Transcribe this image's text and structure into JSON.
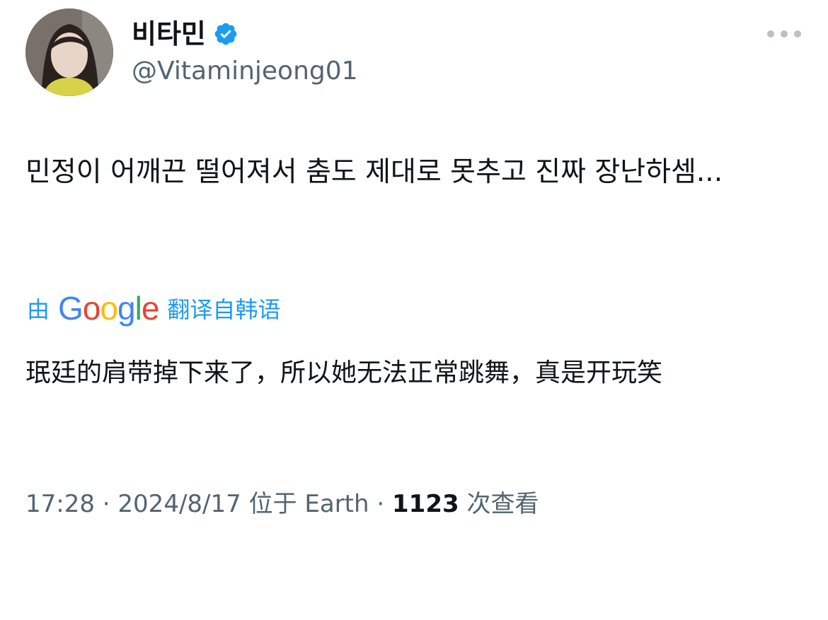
{
  "author": {
    "display_name": "비타민",
    "handle": "@Vitaminjeong01",
    "verified_icon": "verified-badge-icon",
    "verified_color": "#1d9bf0"
  },
  "tweet": {
    "text": "민정이 어깨끈 떨어져서 춤도 제대로 못추고 진짜 장난하셈..."
  },
  "translation": {
    "by_label": "由",
    "google_letters": [
      "G",
      "o",
      "o",
      "g",
      "l",
      "e"
    ],
    "from_label": "翻译自韩语",
    "text": "珉廷的肩带掉下来了，所以她无法正常跳舞，真是开玩笑"
  },
  "meta": {
    "time": "17:28",
    "separator": "·",
    "date": "2024/8/17",
    "location": "位于 Earth",
    "views_count": "1123",
    "views_label": "次查看"
  },
  "colors": {
    "accent": "#1d9bf0",
    "secondary_text": "#536471",
    "google_blue": "#4285f4",
    "google_red": "#ea4335",
    "google_yellow": "#fbbc05",
    "google_green": "#34a853"
  }
}
